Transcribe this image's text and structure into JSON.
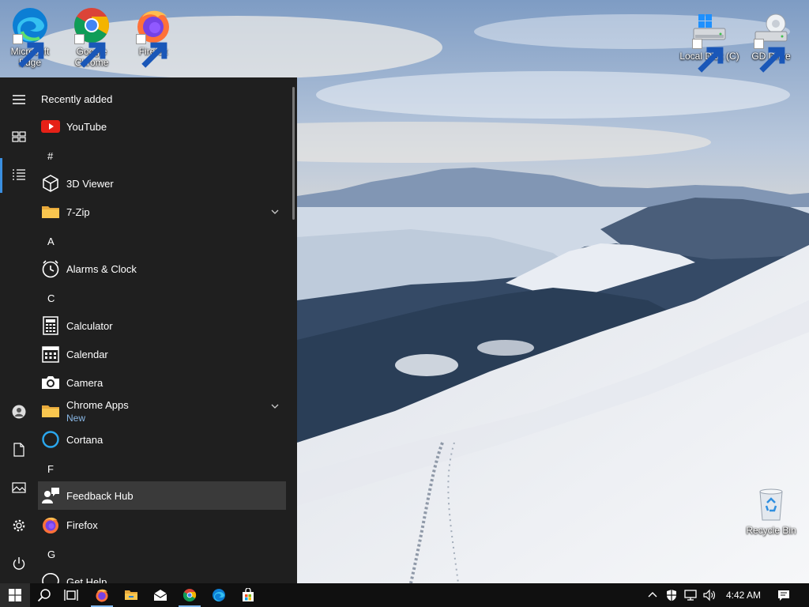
{
  "desktop": {
    "icons": [
      {
        "label": "Microsoft Edge",
        "icon": "edge-icon"
      },
      {
        "label": "Google Chrome",
        "icon": "chrome-icon"
      },
      {
        "label": "Firefox",
        "icon": "firefox-icon"
      },
      {
        "label": "Local Disk (C)",
        "icon": "drive-icon"
      },
      {
        "label": "GD Drive",
        "icon": "network-drive-icon"
      },
      {
        "label": "Recycle Bin",
        "icon": "recycle-bin-icon"
      }
    ]
  },
  "start_menu": {
    "list_title": "Recently added",
    "rail": [
      "menu-icon",
      "tiles-icon",
      "all-apps-icon",
      "user-icon",
      "documents-icon",
      "pictures-icon",
      "settings-icon",
      "power-icon"
    ],
    "letters": {
      "hash": "#",
      "a": "A",
      "c": "C",
      "f": "F",
      "g": "G"
    },
    "apps": [
      {
        "label": "YouTube",
        "icon": "youtube-icon"
      },
      {
        "label": "3D Viewer",
        "icon": "cube-icon"
      },
      {
        "label": "7-Zip",
        "icon": "folder-icon",
        "expandable": true
      },
      {
        "label": "Alarms & Clock",
        "icon": "clock-icon"
      },
      {
        "label": "Calculator",
        "icon": "calculator-icon"
      },
      {
        "label": "Calendar",
        "icon": "calendar-icon"
      },
      {
        "label": "Camera",
        "icon": "camera-icon"
      },
      {
        "label": "Chrome Apps",
        "sublabel": "New",
        "icon": "folder-icon",
        "expandable": true
      },
      {
        "label": "Cortana",
        "icon": "cortana-icon"
      },
      {
        "label": "Feedback Hub",
        "icon": "feedback-icon",
        "highlighted": true
      },
      {
        "label": "Firefox",
        "icon": "firefox-icon"
      },
      {
        "label": "Get Help",
        "icon": "help-icon"
      }
    ]
  },
  "taskbar": {
    "buttons": [
      "windows-start-icon",
      "search-icon",
      "task-view-icon",
      "firefox-icon",
      "file-explorer-icon",
      "mail-icon",
      "chrome-icon",
      "edge-icon",
      "store-icon"
    ],
    "tray": [
      "chevron-up-icon",
      "security-icon",
      "network-icon",
      "volume-icon"
    ],
    "clock": "4:42 AM",
    "notification_icon": "notification-icon"
  },
  "colors": {
    "menu_bg": "#1f1f1f",
    "taskbar_bg": "#101010",
    "accent": "#3a8fe0",
    "new_badge": "#8ab8e6"
  }
}
